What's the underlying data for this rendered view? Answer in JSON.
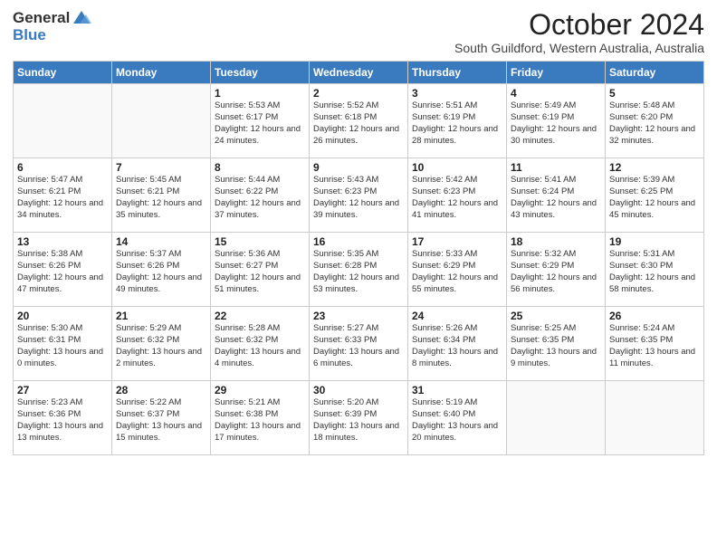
{
  "logo": {
    "general": "General",
    "blue": "Blue"
  },
  "header": {
    "month": "October 2024",
    "subtitle": "South Guildford, Western Australia, Australia"
  },
  "weekdays": [
    "Sunday",
    "Monday",
    "Tuesday",
    "Wednesday",
    "Thursday",
    "Friday",
    "Saturday"
  ],
  "weeks": [
    [
      {
        "day": "",
        "info": ""
      },
      {
        "day": "",
        "info": ""
      },
      {
        "day": "1",
        "info": "Sunrise: 5:53 AM\nSunset: 6:17 PM\nDaylight: 12 hours and 24 minutes."
      },
      {
        "day": "2",
        "info": "Sunrise: 5:52 AM\nSunset: 6:18 PM\nDaylight: 12 hours and 26 minutes."
      },
      {
        "day": "3",
        "info": "Sunrise: 5:51 AM\nSunset: 6:19 PM\nDaylight: 12 hours and 28 minutes."
      },
      {
        "day": "4",
        "info": "Sunrise: 5:49 AM\nSunset: 6:19 PM\nDaylight: 12 hours and 30 minutes."
      },
      {
        "day": "5",
        "info": "Sunrise: 5:48 AM\nSunset: 6:20 PM\nDaylight: 12 hours and 32 minutes."
      }
    ],
    [
      {
        "day": "6",
        "info": "Sunrise: 5:47 AM\nSunset: 6:21 PM\nDaylight: 12 hours and 34 minutes."
      },
      {
        "day": "7",
        "info": "Sunrise: 5:45 AM\nSunset: 6:21 PM\nDaylight: 12 hours and 35 minutes."
      },
      {
        "day": "8",
        "info": "Sunrise: 5:44 AM\nSunset: 6:22 PM\nDaylight: 12 hours and 37 minutes."
      },
      {
        "day": "9",
        "info": "Sunrise: 5:43 AM\nSunset: 6:23 PM\nDaylight: 12 hours and 39 minutes."
      },
      {
        "day": "10",
        "info": "Sunrise: 5:42 AM\nSunset: 6:23 PM\nDaylight: 12 hours and 41 minutes."
      },
      {
        "day": "11",
        "info": "Sunrise: 5:41 AM\nSunset: 6:24 PM\nDaylight: 12 hours and 43 minutes."
      },
      {
        "day": "12",
        "info": "Sunrise: 5:39 AM\nSunset: 6:25 PM\nDaylight: 12 hours and 45 minutes."
      }
    ],
    [
      {
        "day": "13",
        "info": "Sunrise: 5:38 AM\nSunset: 6:26 PM\nDaylight: 12 hours and 47 minutes."
      },
      {
        "day": "14",
        "info": "Sunrise: 5:37 AM\nSunset: 6:26 PM\nDaylight: 12 hours and 49 minutes."
      },
      {
        "day": "15",
        "info": "Sunrise: 5:36 AM\nSunset: 6:27 PM\nDaylight: 12 hours and 51 minutes."
      },
      {
        "day": "16",
        "info": "Sunrise: 5:35 AM\nSunset: 6:28 PM\nDaylight: 12 hours and 53 minutes."
      },
      {
        "day": "17",
        "info": "Sunrise: 5:33 AM\nSunset: 6:29 PM\nDaylight: 12 hours and 55 minutes."
      },
      {
        "day": "18",
        "info": "Sunrise: 5:32 AM\nSunset: 6:29 PM\nDaylight: 12 hours and 56 minutes."
      },
      {
        "day": "19",
        "info": "Sunrise: 5:31 AM\nSunset: 6:30 PM\nDaylight: 12 hours and 58 minutes."
      }
    ],
    [
      {
        "day": "20",
        "info": "Sunrise: 5:30 AM\nSunset: 6:31 PM\nDaylight: 13 hours and 0 minutes."
      },
      {
        "day": "21",
        "info": "Sunrise: 5:29 AM\nSunset: 6:32 PM\nDaylight: 13 hours and 2 minutes."
      },
      {
        "day": "22",
        "info": "Sunrise: 5:28 AM\nSunset: 6:32 PM\nDaylight: 13 hours and 4 minutes."
      },
      {
        "day": "23",
        "info": "Sunrise: 5:27 AM\nSunset: 6:33 PM\nDaylight: 13 hours and 6 minutes."
      },
      {
        "day": "24",
        "info": "Sunrise: 5:26 AM\nSunset: 6:34 PM\nDaylight: 13 hours and 8 minutes."
      },
      {
        "day": "25",
        "info": "Sunrise: 5:25 AM\nSunset: 6:35 PM\nDaylight: 13 hours and 9 minutes."
      },
      {
        "day": "26",
        "info": "Sunrise: 5:24 AM\nSunset: 6:35 PM\nDaylight: 13 hours and 11 minutes."
      }
    ],
    [
      {
        "day": "27",
        "info": "Sunrise: 5:23 AM\nSunset: 6:36 PM\nDaylight: 13 hours and 13 minutes."
      },
      {
        "day": "28",
        "info": "Sunrise: 5:22 AM\nSunset: 6:37 PM\nDaylight: 13 hours and 15 minutes."
      },
      {
        "day": "29",
        "info": "Sunrise: 5:21 AM\nSunset: 6:38 PM\nDaylight: 13 hours and 17 minutes."
      },
      {
        "day": "30",
        "info": "Sunrise: 5:20 AM\nSunset: 6:39 PM\nDaylight: 13 hours and 18 minutes."
      },
      {
        "day": "31",
        "info": "Sunrise: 5:19 AM\nSunset: 6:40 PM\nDaylight: 13 hours and 20 minutes."
      },
      {
        "day": "",
        "info": ""
      },
      {
        "day": "",
        "info": ""
      }
    ]
  ]
}
